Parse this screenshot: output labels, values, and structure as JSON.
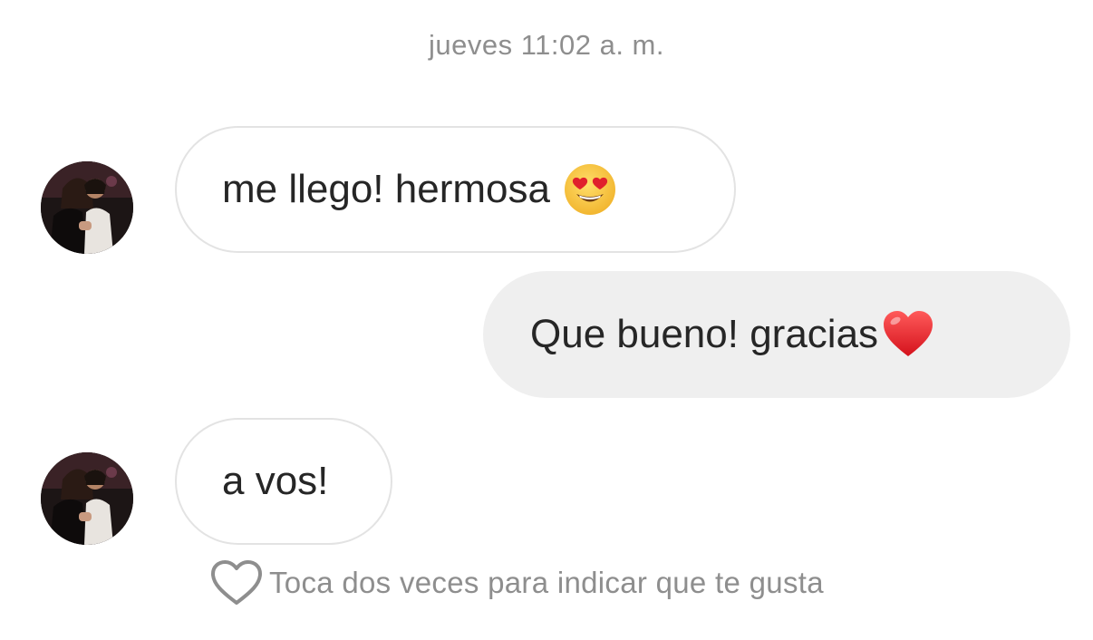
{
  "thread": {
    "timestamp": "jueves 11:02 a. m.",
    "messages": [
      {
        "direction": "incoming",
        "text": "me llego! hermosa",
        "emoji": "smiling-face-heart-eyes-icon"
      },
      {
        "direction": "outgoing",
        "text": "Que bueno!  gracias",
        "emoji": "red-heart-icon"
      },
      {
        "direction": "incoming",
        "text": "a vos!",
        "emoji": ""
      }
    ],
    "like_hint": "Toca dos veces para indicar que te gusta",
    "like_icon": "heart-outline-icon"
  },
  "colors": {
    "background": "#ffffff",
    "secondary_text": "#8e8e8e",
    "primary_text": "#262626",
    "incoming_border": "#e3e3e3",
    "outgoing_fill": "#efefef",
    "heart_red": "#e0202c",
    "emoji_yellow": "#f7c53b"
  }
}
